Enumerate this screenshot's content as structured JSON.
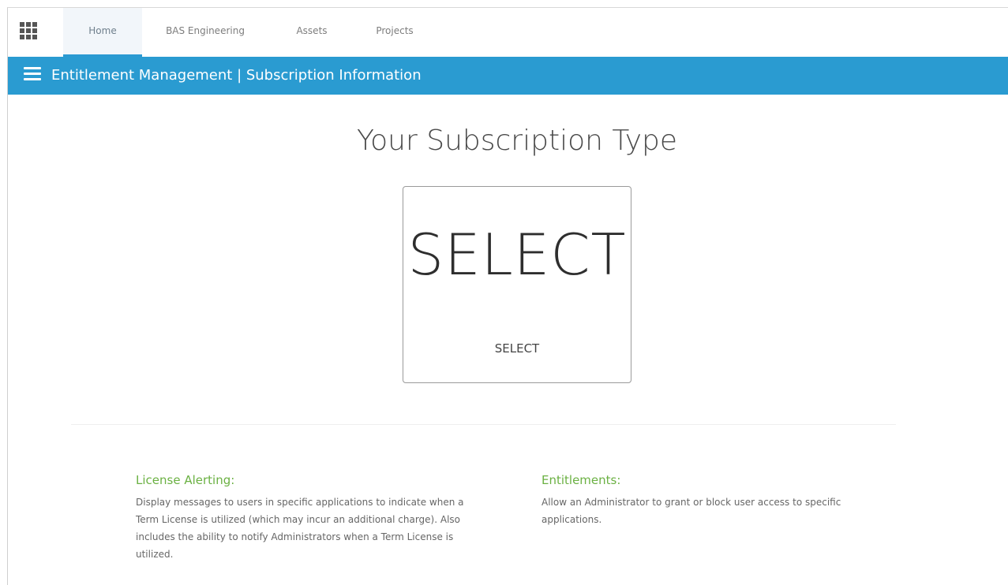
{
  "nav": {
    "tabs": [
      {
        "label": "Home",
        "active": true
      },
      {
        "label": "BAS Engineering",
        "active": false
      },
      {
        "label": "Assets",
        "active": false
      },
      {
        "label": "Projects",
        "active": false
      }
    ],
    "apps_icon": "grid-icon"
  },
  "header": {
    "menu_icon": "hamburger-icon",
    "title": "Entitlement Management | Subscription Information"
  },
  "main": {
    "title": "Your Subscription Type",
    "card": {
      "big_text": "SELECT",
      "small_text": "SELECT"
    },
    "features": [
      {
        "title": "License Alerting:",
        "text": "Display messages to users in specific applications to indicate when a Term License is utilized (which may incur an additional charge). Also includes the ability to notify Administrators when a Term License is utilized."
      },
      {
        "title": "Entitlements:",
        "text": "Allow an Administrator to grant or block user access to specific applications."
      }
    ]
  },
  "colors": {
    "header_bar": "#2a9bd1",
    "feature_title": "#6bb143",
    "active_tab_underline": "#2b9ad2"
  }
}
